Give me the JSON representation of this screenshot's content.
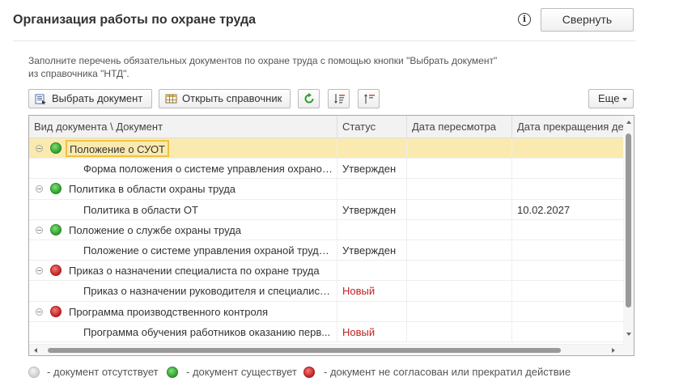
{
  "header": {
    "title": "Организация работы по охране труда",
    "info_icon": "info-icon",
    "collapse_label": "Свернуть"
  },
  "hint": {
    "line1": "Заполните перечень обязательных документов по охране труда с помощью кнопки \"Выбрать документ\"",
    "line2": "из справочника \"НТД\"."
  },
  "toolbar": {
    "select_document_label": "Выбрать документ",
    "open_catalog_label": "Открыть справочник",
    "refresh_icon": "refresh-icon",
    "sort_down_icon": "sort-descending-icon",
    "sort_up_icon": "sort-ascending-icon",
    "more_label": "Еще"
  },
  "table": {
    "columns": [
      "Вид документа \\ Документ",
      "Статус",
      "Дата пересмотра",
      "Дата прекращения де"
    ],
    "rows": [
      {
        "type": "group",
        "status_color": "green",
        "label": "Положение о СУОТ",
        "status": "",
        "review_date": "",
        "end_date": ""
      },
      {
        "type": "item",
        "label": "Форма положения о системе управления охраной...",
        "status": "Утвержден",
        "review_date": "",
        "end_date": ""
      },
      {
        "type": "group",
        "status_color": "green",
        "label": "Политика в области охраны труда",
        "status": "",
        "review_date": "",
        "end_date": ""
      },
      {
        "type": "item",
        "label": "Политика в области ОТ",
        "status": "Утвержден",
        "review_date": "",
        "end_date": "10.02.2027"
      },
      {
        "type": "group",
        "status_color": "green",
        "label": "Положение о службе охраны труда",
        "status": "",
        "review_date": "",
        "end_date": ""
      },
      {
        "type": "item",
        "label": "Положение о системе управления охраной труда ...",
        "status": "Утвержден",
        "review_date": "",
        "end_date": ""
      },
      {
        "type": "group",
        "status_color": "red",
        "label": "Приказ о назначении специалиста по охране труда",
        "status": "",
        "review_date": "",
        "end_date": ""
      },
      {
        "type": "item",
        "label": "Приказ о назначении руководителя и специалисто...",
        "status": "Новый",
        "review_date": "",
        "end_date": ""
      },
      {
        "type": "group",
        "status_color": "red",
        "label": "Программа производственного контроля",
        "status": "",
        "review_date": "",
        "end_date": ""
      },
      {
        "type": "item",
        "label": "Программа обучения работников оказанию перв...",
        "status": "Новый",
        "review_date": "",
        "end_date": ""
      }
    ]
  },
  "legend": {
    "missing": "- документ отсутствует",
    "exists": "- документ существует",
    "invalid": "- документ не согласован или прекратил действие"
  },
  "colors": {
    "green": "#2e9e2a",
    "red": "#c42222",
    "gray": "#cfcfcf",
    "selection": "#fbeab0",
    "focus_border": "#f0c13a",
    "new_status": "#c42020"
  }
}
